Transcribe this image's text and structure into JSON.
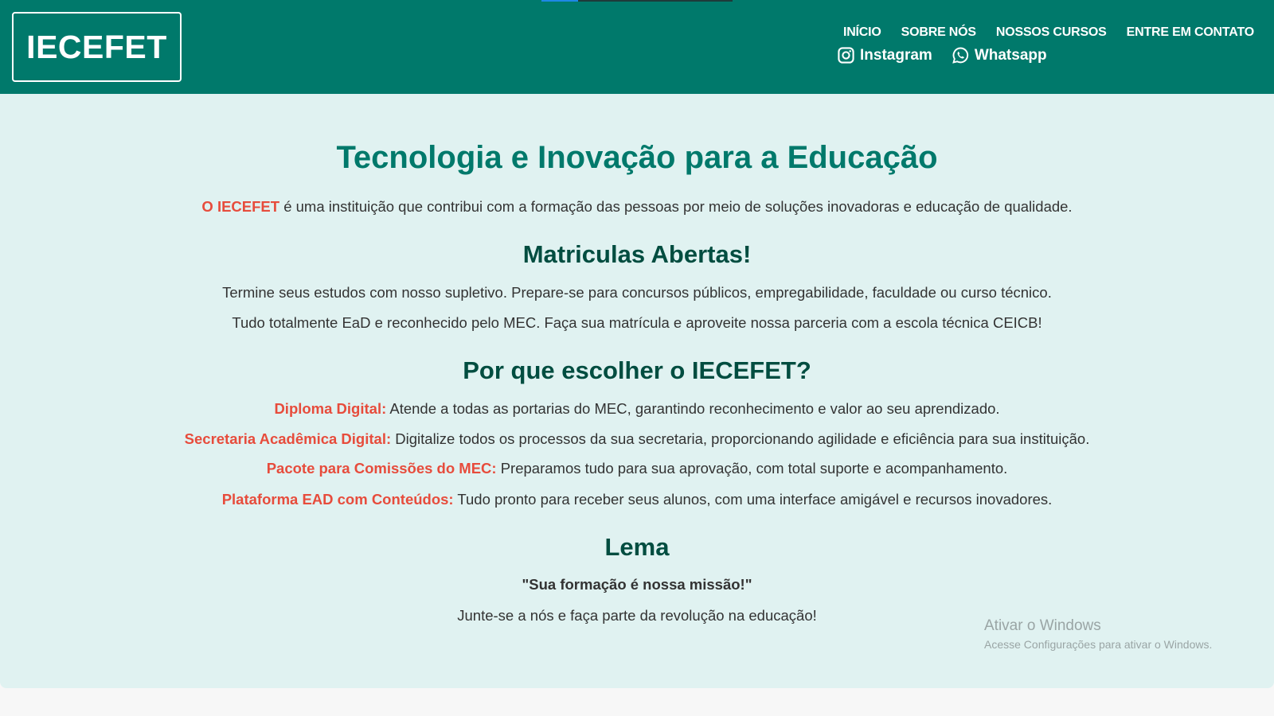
{
  "brand": {
    "logo": "IECEFET"
  },
  "nav": {
    "items": [
      "INÍCIO",
      "SOBRE NÓS",
      "NOSSOS CURSOS",
      "ENTRE EM CONTATO"
    ]
  },
  "social": {
    "instagram": {
      "label": "Instagram",
      "icon": "instagram-icon"
    },
    "whatsapp": {
      "label": "Whatsapp",
      "icon": "whatsapp-icon"
    }
  },
  "hero": {
    "title": "Tecnologia e Inovação para a Educação",
    "intro_highlight": "O IECEFET",
    "intro_text": " é uma instituição que contribui com a formação das pessoas por meio de soluções inovadoras e educação de qualidade."
  },
  "enrollment": {
    "heading": "Matriculas Abertas!",
    "line1": "Termine seus estudos com nosso supletivo. Prepare-se para concursos públicos, empregabilidade, faculdade ou curso técnico.",
    "line2": "Tudo totalmente EaD e reconhecido pelo MEC. Faça sua matrícula e aproveite nossa parceria com a escola técnica CEICB!"
  },
  "why": {
    "heading": "Por que escolher o IECEFET?",
    "items": [
      {
        "label": "Diploma Digital:",
        "text": " Atende a todas as portarias do MEC, garantindo reconhecimento e valor ao seu aprendizado."
      },
      {
        "label": "Secretaria Acadêmica Digital:",
        "text": " Digitalize todos os processos da sua secretaria, proporcionando agilidade e eficiência para sua instituição."
      },
      {
        "label": "Pacote para Comissões do MEC:",
        "text": " Preparamos tudo para sua aprovação, com total suporte e acompanhamento."
      },
      {
        "label": "Plataforma EAD com Conteúdos:",
        "text": " Tudo pronto para receber seus alunos, com uma interface amigável e recursos inovadores."
      }
    ]
  },
  "motto": {
    "heading": "Lema",
    "quote": "\"Sua formação é nossa missão!\"",
    "text": "Junte-se a nós e faça parte da revolução na educação!"
  },
  "watermark": {
    "title": "Ativar o Windows",
    "subtitle": "Acesse Configurações para ativar o Windows."
  },
  "colors": {
    "header_bg": "#00796b",
    "content_bg": "#e0f2f1",
    "title": "#00796b",
    "heading": "#004d40",
    "highlight": "#e74c3c"
  }
}
